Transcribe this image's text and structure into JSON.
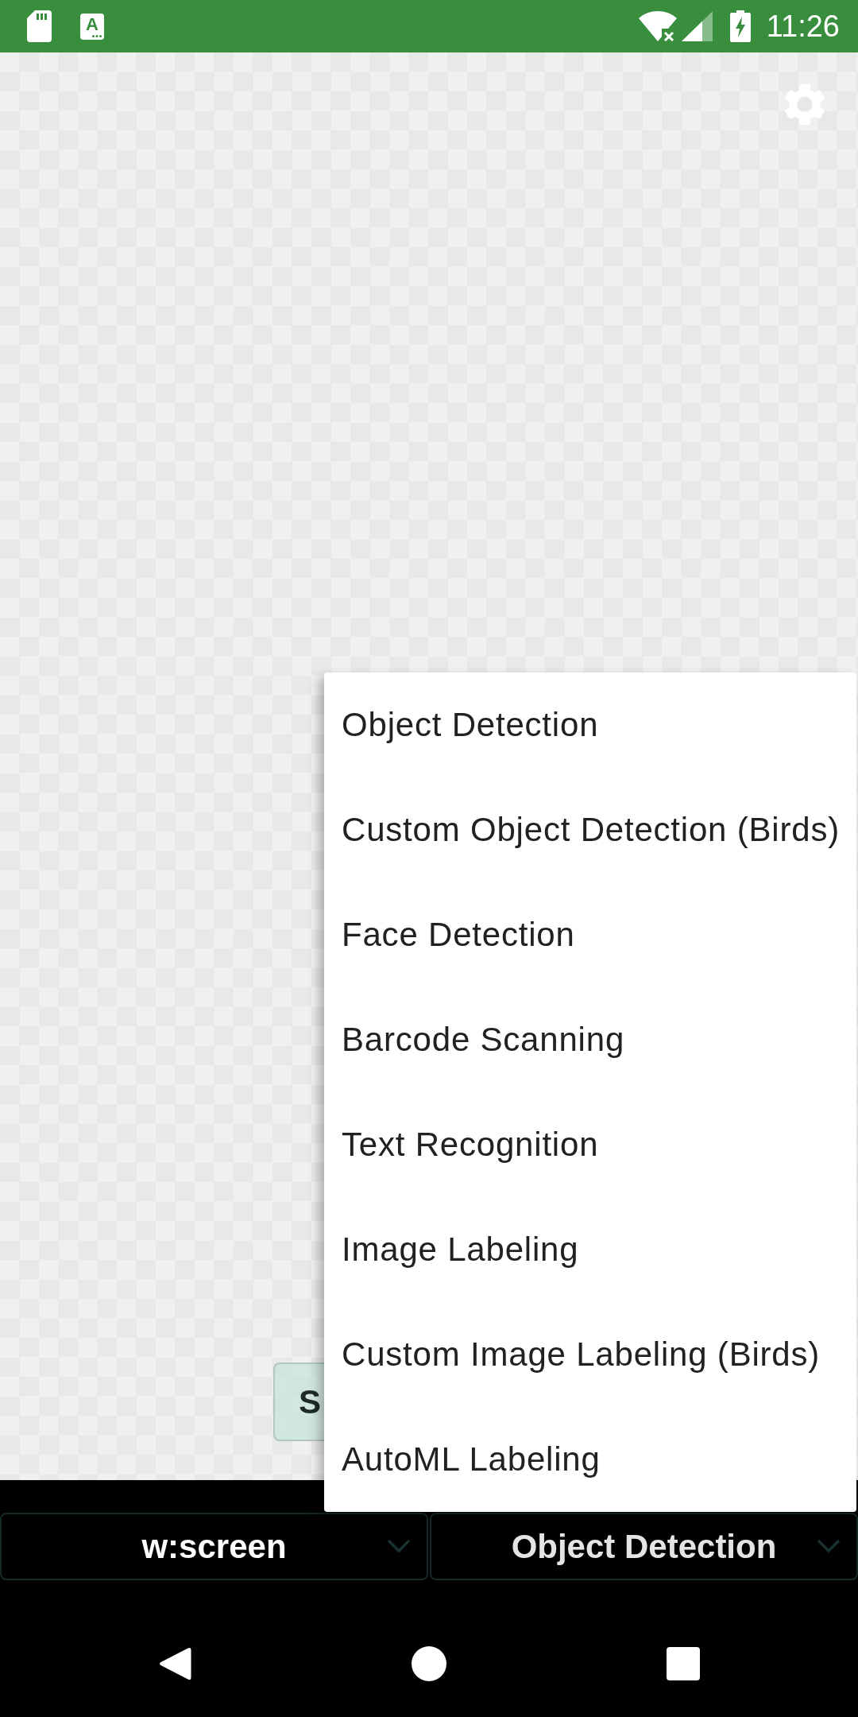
{
  "status_bar": {
    "notification_letter": "A",
    "time": "11:26"
  },
  "preview": {
    "button": {
      "label": "S"
    }
  },
  "dropdown_menu": {
    "items": [
      {
        "label": "Object Detection"
      },
      {
        "label": "Custom Object Detection (Birds)"
      },
      {
        "label": "Face Detection"
      },
      {
        "label": "Barcode Scanning"
      },
      {
        "label": "Text Recognition"
      },
      {
        "label": "Image Labeling"
      },
      {
        "label": "Custom Image Labeling (Birds)"
      },
      {
        "label": "AutoML Labeling"
      }
    ]
  },
  "spinners": [
    {
      "value": "w:screen",
      "expanded": false
    },
    {
      "value": "Object Detection",
      "expanded": true
    }
  ]
}
